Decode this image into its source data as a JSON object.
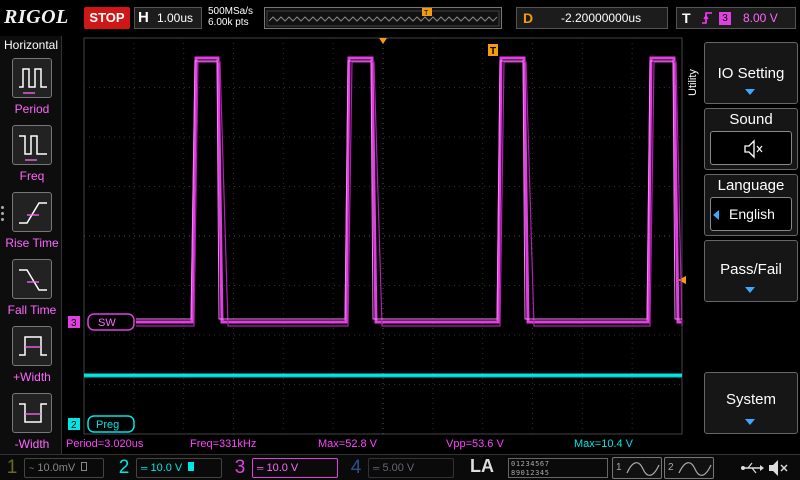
{
  "header": {
    "brand": "RIGOL",
    "run_state": "STOP",
    "timebase": {
      "label": "H",
      "value": "1.00us"
    },
    "sample_rate": "500MSa/s",
    "memory_depth": "6.00k pts",
    "delay": {
      "label": "D",
      "value": "-2.20000000us"
    },
    "trigger": {
      "label": "T",
      "edge": "rising-edge-icon",
      "source": "3",
      "level": "8.00 V"
    },
    "trigger_marker": "T"
  },
  "left_panel": {
    "title": "Horizontal",
    "items": [
      {
        "label": "Period",
        "icon": "period-icon"
      },
      {
        "label": "Freq",
        "icon": "freq-icon"
      },
      {
        "label": "Rise Time",
        "icon": "rise-time-icon"
      },
      {
        "label": "Fall Time",
        "icon": "fall-time-icon"
      },
      {
        "label": "+Width",
        "icon": "positive-width-icon"
      },
      {
        "label": "-Width",
        "icon": "negative-width-icon"
      }
    ]
  },
  "channels": {
    "ch3": {
      "marker": "3",
      "label": "SW",
      "color": "#e040e0"
    },
    "ch2": {
      "marker": "2",
      "label": "Preg",
      "color": "#00e5e5"
    }
  },
  "measurements": {
    "period": "Period=3.020us",
    "freq": "Freq=331kHz",
    "max": "Max=52.8 V",
    "vpp": "Vpp=53.6 V",
    "max2": "Max=10.4 V"
  },
  "right_menu": {
    "tab": "Utility",
    "io_setting": "IO Setting",
    "sound": "Sound",
    "sound_icon": "speaker-mute-icon",
    "language": "Language",
    "language_value": "English",
    "pass_fail": "Pass/Fail",
    "system": "System"
  },
  "bottom_bar": {
    "ch1": {
      "num": "1",
      "scale": "10.0mV",
      "color": "#f5e600"
    },
    "ch2": {
      "num": "2",
      "scale": "10.0 V",
      "color": "#00e5e5"
    },
    "ch3": {
      "num": "3",
      "scale": "10.0 V",
      "color": "#e040e0"
    },
    "ch4": {
      "num": "4",
      "scale": "5.00 V",
      "color": "#3d7fff"
    },
    "la": "LA",
    "la_bits_top": "01234567",
    "la_bits_bottom": "89012345",
    "gen1": "1",
    "gen2": "2",
    "usb_icon": "usb-icon",
    "mute_icon": "speaker-mute-icon"
  },
  "colors": {
    "ch3_wave": "#e040e0",
    "ch2_wave": "#00e5e5",
    "trigger": "#f39c12",
    "stop": "#d01717",
    "menu_accent": "#3da8ff"
  }
}
